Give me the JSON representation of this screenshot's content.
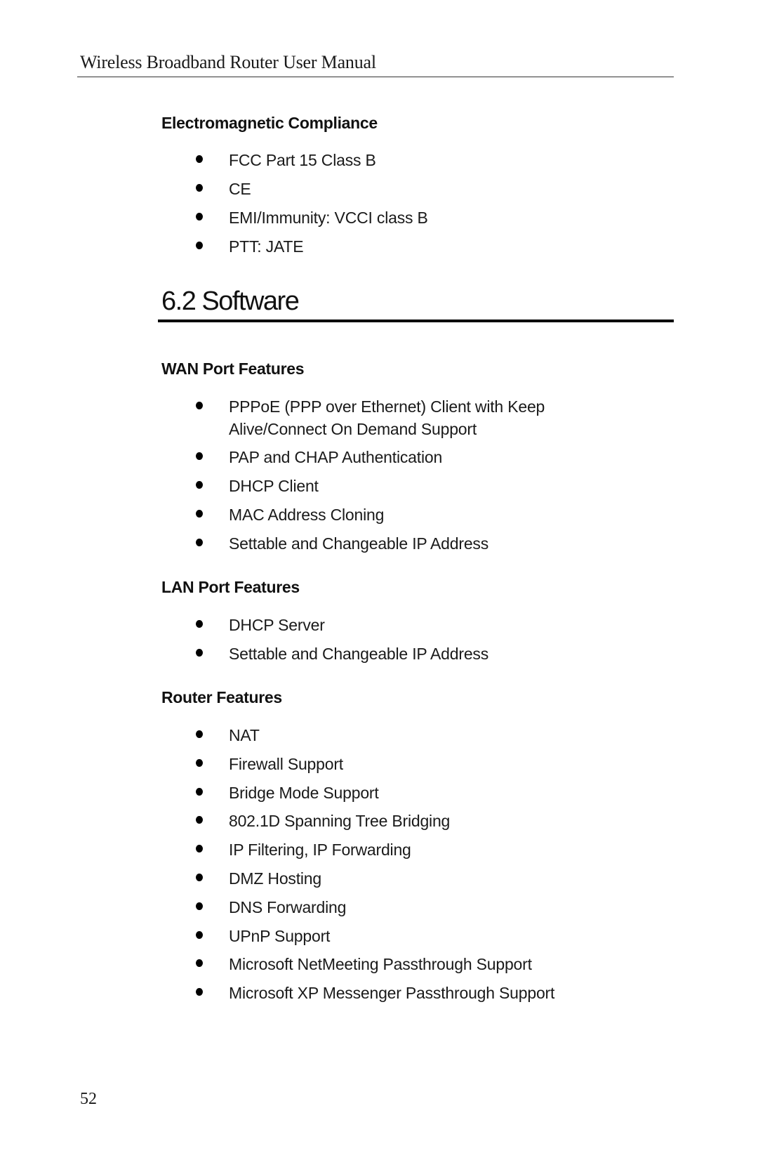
{
  "header": {
    "title": "Wireless Broadband Router User Manual"
  },
  "emc": {
    "heading": "Electromagnetic Compliance",
    "items": [
      "FCC Part 15 Class B",
      "CE",
      "EMI/Immunity: VCCI class B",
      "PTT: JATE"
    ]
  },
  "section": {
    "title": "6.2 Software"
  },
  "wan": {
    "heading": "WAN Port Features",
    "items": [
      "PPPoE (PPP over Ethernet) Client with Keep Alive/Connect On Demand Support",
      "PAP and CHAP Authentication",
      "DHCP Client",
      "MAC Address Cloning",
      "Settable and Changeable IP Address"
    ]
  },
  "lan": {
    "heading": "LAN Port Features",
    "items": [
      "DHCP Server",
      "Settable and Changeable IP Address"
    ]
  },
  "router": {
    "heading": "Router Features",
    "items": [
      "NAT",
      "Firewall Support",
      "Bridge Mode Support",
      "802.1D Spanning Tree Bridging",
      "IP Filtering, IP Forwarding",
      "DMZ Hosting",
      "DNS Forwarding",
      "UPnP Support",
      "Microsoft NetMeeting Passthrough Support",
      "Microsoft XP Messenger Passthrough Support"
    ]
  },
  "footer": {
    "page_number": "52"
  }
}
